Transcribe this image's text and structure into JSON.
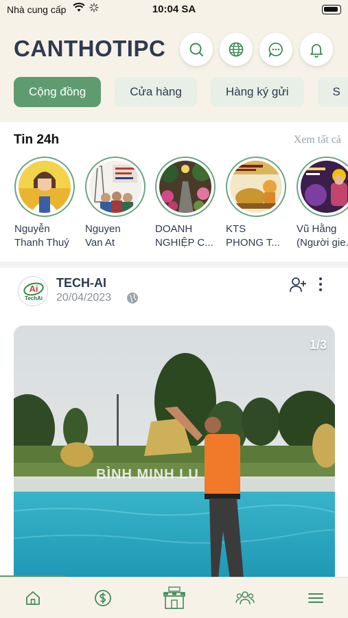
{
  "status_bar": {
    "carrier": "Nhà cung cấp",
    "time": "10:04 SA"
  },
  "header": {
    "brand": "CANTHOTIPC",
    "icons": [
      "search-icon",
      "globe-icon",
      "chat-icon",
      "bell-icon"
    ]
  },
  "tabs": [
    {
      "label": "Cộng đồng",
      "active": true
    },
    {
      "label": "Cửa hàng",
      "active": false
    },
    {
      "label": "Hàng ký gửi",
      "active": false
    },
    {
      "label": "S",
      "active": false
    }
  ],
  "stories": {
    "title": "Tin 24h",
    "see_all": "Xem tất cả",
    "items": [
      {
        "line1": "Nguyễn",
        "line2": "Thanh Thuý"
      },
      {
        "line1": "Nguyen",
        "line2": "Van At"
      },
      {
        "line1": "DOANH",
        "line2": "NGHIỆP C..."
      },
      {
        "line1": "KTS",
        "line2": "PHONG T..."
      },
      {
        "line1": "Vũ Hằng",
        "line2": "(Người gie..."
      }
    ]
  },
  "post": {
    "author": "TECH-AI",
    "date": "20/04/2023",
    "avatar_text": "TechAi",
    "media_counter": "1/3",
    "media_overlay_text": "BÌNH MINH LU"
  },
  "bottom_nav": [
    "home-icon",
    "dollar-icon",
    "shop-icon",
    "people-icon",
    "menu-icon"
  ],
  "colors": {
    "accent": "#5e9c70",
    "header_bg": "#f7f2e8",
    "tab_bg": "#e7efe6",
    "brand_text": "#2e3a4f"
  }
}
